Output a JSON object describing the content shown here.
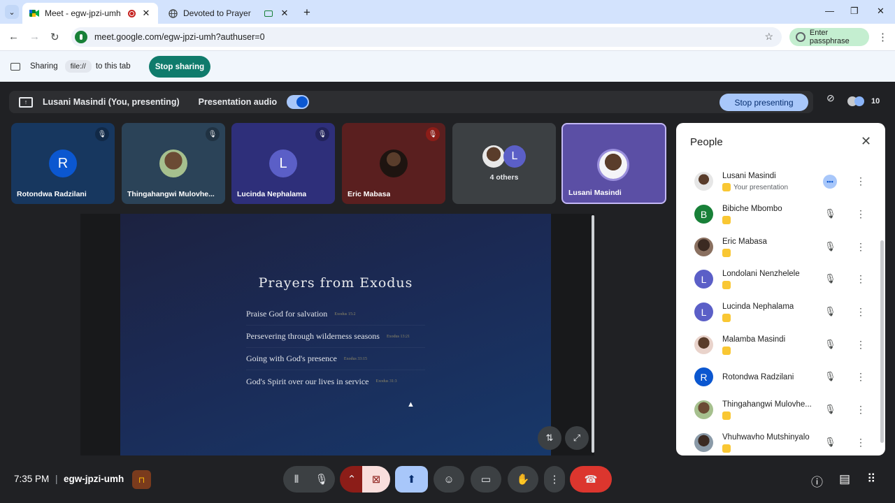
{
  "browser": {
    "tabs": [
      {
        "title": "Meet - egw-jpzi-umh",
        "active": true
      },
      {
        "title": "Devoted to Prayer",
        "active": false
      }
    ],
    "url": "meet.google.com/egw-jpzi-umh?authuser=0",
    "passphrase_label": "Enter passphrase"
  },
  "sharebar": {
    "sharing_label": "Sharing",
    "source": "file://",
    "target": "to this tab",
    "stop_label": "Stop sharing"
  },
  "presenting_bar": {
    "presenter": "Lusani Masindi (You, presenting)",
    "audio_label": "Presentation audio",
    "stop_label": "Stop presenting",
    "participant_count": "10"
  },
  "tiles": [
    {
      "name": "Rotondwa Radzilani",
      "initial": "R",
      "color": "#0b57d0",
      "bg": "#17375f",
      "muted": true
    },
    {
      "name": "Thingahangwi Mulovhe...",
      "initial": "",
      "color": "#5b7a4a",
      "bg": "#2b4358",
      "muted": true
    },
    {
      "name": "Lucinda Nephalama",
      "initial": "L",
      "color": "#5b5fc7",
      "bg": "#2e2f7a",
      "muted": true
    },
    {
      "name": "Eric Mabasa",
      "initial": "",
      "color": "#2a1a14",
      "bg": "#5a1f1f",
      "muted": true
    },
    {
      "name": "",
      "others": "4 others",
      "bg": "#3c4043"
    },
    {
      "name": "Lusani Masindi",
      "initial": "",
      "color": "#e8e8f0",
      "bg": "#5b4fa5",
      "muted": false
    }
  ],
  "slide": {
    "title": "Prayers from Exodus",
    "items": [
      {
        "text": "Praise God for salvation",
        "ref": "Exodus 15:2"
      },
      {
        "text": "Persevering through wilderness seasons",
        "ref": "Exodus 13:21"
      },
      {
        "text": "Going with God's presence",
        "ref": "Exodus 33:15"
      },
      {
        "text": "God's Spirit over our lives in service",
        "ref": "Exodus 31:3"
      }
    ]
  },
  "people": {
    "title": "People",
    "list": [
      {
        "name": "Lusani Masindi",
        "sub": "Your presentation",
        "initial": "",
        "color": "#d7d7d7",
        "self": true
      },
      {
        "name": "Bibiche Mbombo",
        "sub": "",
        "initial": "B",
        "color": "#188038"
      },
      {
        "name": "Eric Mabasa",
        "sub": "",
        "initial": "",
        "color": "#3b2a22"
      },
      {
        "name": "Londolani Nenzhelele",
        "sub": "",
        "initial": "L",
        "color": "#5b5fc7"
      },
      {
        "name": "Lucinda Nephalama",
        "sub": "",
        "initial": "L",
        "color": "#5b5fc7"
      },
      {
        "name": "Malamba Masindi",
        "sub": "",
        "initial": "",
        "color": "#c69b86"
      },
      {
        "name": "Rotondwa Radzilani",
        "sub": "",
        "initial": "R",
        "color": "#0b57d0",
        "no_badge": true
      },
      {
        "name": "Thingahangwi Mulovhe...",
        "sub": "",
        "initial": "",
        "color": "#6a8aa8"
      },
      {
        "name": "Vhuhwavho Mutshinyalo",
        "sub": "",
        "initial": "",
        "color": "#8a9aa8"
      }
    ]
  },
  "bottom": {
    "time": "7:35 PM",
    "separator": "|",
    "meeting_code": "egw-jpzi-umh"
  }
}
